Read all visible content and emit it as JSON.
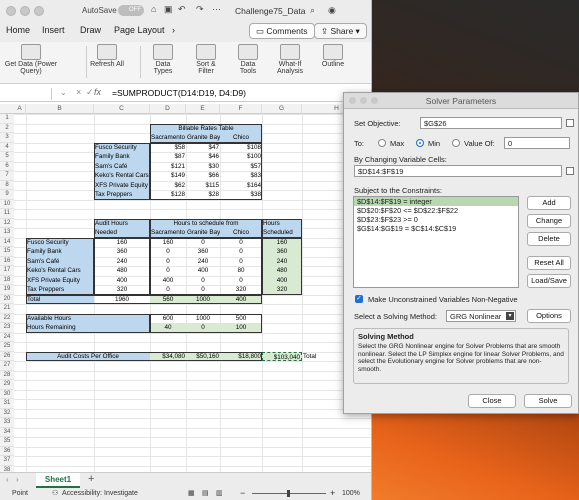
{
  "app": {
    "title": "Challenge75_Data",
    "autosave_label": "AutoSave",
    "autosave_state": "OFF"
  },
  "ribbon_tabs": [
    "Home",
    "Insert",
    "Draw",
    "Page Layout"
  ],
  "comments_label": "Comments",
  "share_label": "Share",
  "ribbon_groups": [
    "Get Data (Power Query)",
    "Refresh All",
    "Data Types",
    "Sort & Filter",
    "Data Tools",
    "What-If Analysis",
    "Outline"
  ],
  "formula_bar": {
    "fx": "fx",
    "formula": "=SUMPRODUCT(D14:D19, D4:D9)"
  },
  "columns": [
    "A",
    "B",
    "C",
    "D",
    "E",
    "F",
    "G",
    "H"
  ],
  "rows": [
    "1",
    "2",
    "3",
    "4",
    "5",
    "6",
    "7",
    "8",
    "9",
    "10",
    "11",
    "12",
    "13",
    "14",
    "15",
    "16",
    "17",
    "18",
    "19",
    "20",
    "21",
    "22",
    "23",
    "24",
    "25",
    "26",
    "27",
    "28",
    "29",
    "30",
    "31",
    "32",
    "33",
    "34",
    "35",
    "36",
    "37",
    "38"
  ],
  "rates_table": {
    "title": "Billable Rates Table",
    "headers": [
      "Sacramento",
      "Granite Bay",
      "Chico"
    ],
    "rows": [
      {
        "name": "Fusco Security",
        "v": [
          "$58",
          "$47",
          "$108"
        ]
      },
      {
        "name": "Family Bank",
        "v": [
          "$87",
          "$46",
          "$100"
        ]
      },
      {
        "name": "Sam's Café",
        "v": [
          "$121",
          "$30",
          "$57"
        ]
      },
      {
        "name": "Keko's Rental Cars",
        "v": [
          "$149",
          "$66",
          "$83"
        ]
      },
      {
        "name": "XFS Private Equity",
        "v": [
          "$62",
          "$115",
          "$164"
        ]
      },
      {
        "name": "Tax Preppers",
        "v": [
          "$128",
          "$28",
          "$38"
        ]
      }
    ]
  },
  "hours_table": {
    "needed_label1": "Audit Hours",
    "needed_label2": "Needed",
    "sched_title": "Hours to schedule from",
    "headers": [
      "Sacramento",
      "Granite Bay",
      "Chico"
    ],
    "scheduled_label1": "Hours",
    "scheduled_label2": "Scheduled",
    "rows": [
      {
        "name": "Fusco Security",
        "needed": "160",
        "v": [
          "160",
          "0",
          "0"
        ],
        "sched": "160"
      },
      {
        "name": "Family Bank",
        "needed": "360",
        "v": [
          "0",
          "360",
          "0"
        ],
        "sched": "360"
      },
      {
        "name": "Sam's Café",
        "needed": "240",
        "v": [
          "0",
          "240",
          "0"
        ],
        "sched": "240"
      },
      {
        "name": "Keko's Rental Cars",
        "needed": "480",
        "v": [
          "0",
          "400",
          "80"
        ],
        "sched": "480"
      },
      {
        "name": "XFS Private Equity",
        "needed": "400",
        "v": [
          "400",
          "0",
          "0"
        ],
        "sched": "400"
      },
      {
        "name": "Tax Preppers",
        "needed": "320",
        "v": [
          "0",
          "0",
          "320"
        ],
        "sched": "320"
      }
    ],
    "total_label": "Total",
    "total": {
      "needed": "1960",
      "v": [
        "560",
        "1000",
        "400"
      ]
    }
  },
  "available": {
    "label": "Available Hours",
    "v": [
      "600",
      "1000",
      "500"
    ]
  },
  "remaining": {
    "label": "Hours Remaining",
    "v": [
      "40",
      "0",
      "100"
    ]
  },
  "audit_costs": {
    "label": "Audit Costs Per Office",
    "v": [
      "$34,080",
      "$50,160",
      "$18,800"
    ],
    "total": "$103,040",
    "total_label": "Total"
  },
  "sheet_tab": "Sheet1",
  "status": {
    "mode": "Point",
    "accessibility": "Accessibility: Investigate",
    "zoom": "100%"
  },
  "solver": {
    "title": "Solver Parameters",
    "set_objective_label": "Set Objective:",
    "set_objective": "$G$26",
    "to_label": "To:",
    "max_label": "Max",
    "min_label": "Min",
    "valueof_label": "Value Of:",
    "valueof": "0",
    "changing_label": "By Changing Variable Cells:",
    "changing": "$D$14:$F$19",
    "constraints_label": "Subject to the Constraints:",
    "constraints": [
      "$D$14:$F$19 = integer",
      "$D$20:$F$20 <= $D$22:$F$22",
      "$D$23:$F$23 >= 0",
      "$G$14:$G$19 = $C$14:$C$19"
    ],
    "btn_add": "Add",
    "btn_change": "Change",
    "btn_delete": "Delete",
    "btn_reset": "Reset All",
    "btn_load": "Load/Save",
    "nonneg_label": "Make Unconstrained Variables Non-Negative",
    "method_label": "Select a Solving Method:",
    "method": "GRG Nonlinear",
    "btn_options": "Options",
    "method_title": "Solving Method",
    "method_desc": "Select the GRG Nonlinear engine for Solver Problems that are smooth nonlinear. Select the LP Simplex engine for linear Solver Problems, and select the Evolutionary engine for Solver problems that are non-smooth.",
    "btn_close": "Close",
    "btn_solve": "Solve"
  }
}
